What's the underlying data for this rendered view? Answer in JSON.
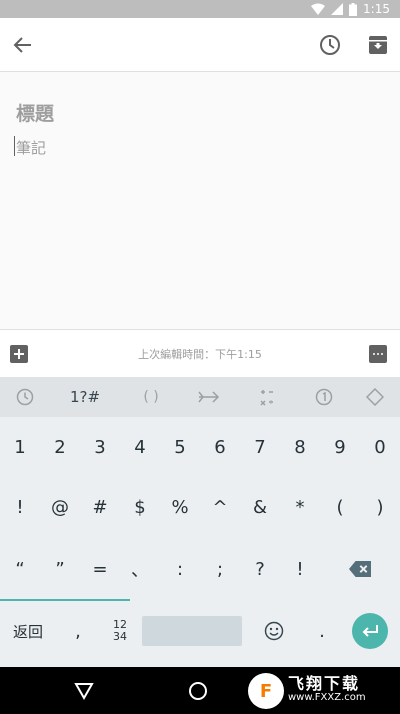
{
  "status_bar": {
    "time": "1:15"
  },
  "editor": {
    "title_placeholder": "標題",
    "note_placeholder": "筆記"
  },
  "bottom_bar": {
    "last_edited": "上次編輯時間：下午1:15"
  },
  "keyboard": {
    "top_row": {
      "symbols_label": "1?#",
      "brackets_label": "( )"
    },
    "row1": [
      "1",
      "2",
      "3",
      "4",
      "5",
      "6",
      "7",
      "8",
      "9",
      "0"
    ],
    "row2": [
      "!",
      "@",
      "#",
      "$",
      "%",
      "^",
      "&",
      "*",
      "(",
      ")"
    ],
    "row3": [
      "“",
      "”",
      "=",
      "、",
      ":",
      ";",
      "?",
      "!"
    ],
    "bottom": {
      "back_label": "返回",
      "comma": ",",
      "abc_line1": "12",
      "abc_line2": "34",
      "period": "."
    }
  },
  "watermark": {
    "cn": "飞翔下载",
    "en": "www.FXXZ.com"
  },
  "colors": {
    "accent": "#4db6ac",
    "status_bar": "#bdbdbd",
    "icon": "#616161"
  },
  "icons": {
    "back": "arrow-left-icon",
    "reminder": "clock-icon",
    "archive": "archive-icon",
    "add": "add-box-icon",
    "more": "more-icon",
    "delete": "backspace-icon",
    "enter": "enter-icon"
  }
}
